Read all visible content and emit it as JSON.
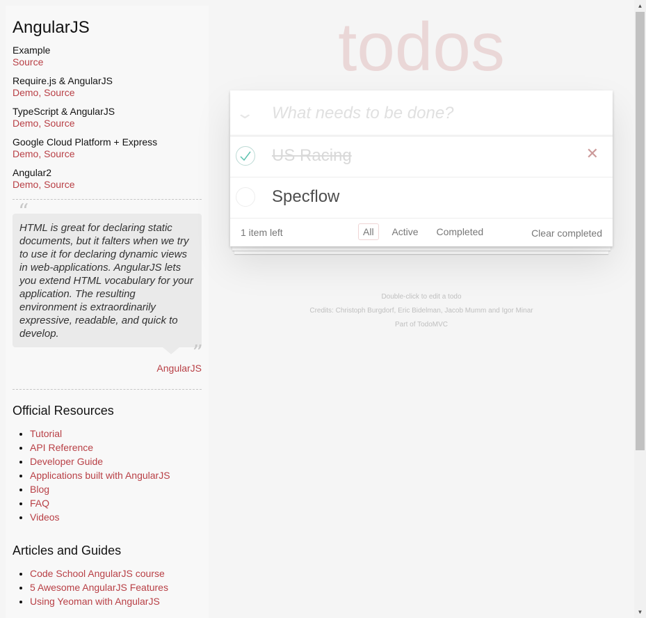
{
  "sidebar": {
    "title": "AngularJS",
    "examples": [
      {
        "name": "Example",
        "links": [
          "Source"
        ]
      },
      {
        "name": "Require.js & AngularJS",
        "links": [
          "Demo",
          "Source"
        ]
      },
      {
        "name": "TypeScript & AngularJS",
        "links": [
          "Demo",
          "Source"
        ]
      },
      {
        "name": "Google Cloud Platform + Express",
        "links": [
          "Demo",
          "Source"
        ]
      },
      {
        "name": "Angular2",
        "links": [
          "Demo",
          "Source"
        ]
      }
    ],
    "quote": "HTML is great for declaring static documents, but it falters when we try to use it for declaring dynamic views in web-applications. AngularJS lets you extend HTML vocabulary for your application. The resulting environment is extraordinarily expressive, readable, and quick to develop.",
    "quote_source": "AngularJS",
    "official_title": "Official Resources",
    "official_links": [
      "Tutorial",
      "API Reference",
      "Developer Guide",
      "Applications built with AngularJS",
      "Blog",
      "FAQ",
      "Videos"
    ],
    "articles_title": "Articles and Guides",
    "articles_links": [
      "Code School AngularJS course",
      "5 Awesome AngularJS Features",
      "Using Yeoman with AngularJS"
    ]
  },
  "app": {
    "title": "todos",
    "new_todo_placeholder": "What needs to be done?",
    "todos": [
      {
        "label": "US Racing",
        "completed": true
      },
      {
        "label": "Specflow",
        "completed": false
      }
    ],
    "count_text": "1 item left",
    "filters": [
      "All",
      "Active",
      "Completed"
    ],
    "selected_filter": "All",
    "clear_completed": "Clear completed"
  },
  "info": {
    "edit_hint": "Double-click to edit a todo",
    "credits": "Credits: Christoph Burgdorf, Eric Bidelman, Jacob Mumm and Igor Minar",
    "part_of": "Part of TodoMVC"
  },
  "colors": {
    "accent": "#b83f45",
    "title_color": "rgba(175,47,47,0.15)",
    "check_color": "#5dc2af"
  }
}
